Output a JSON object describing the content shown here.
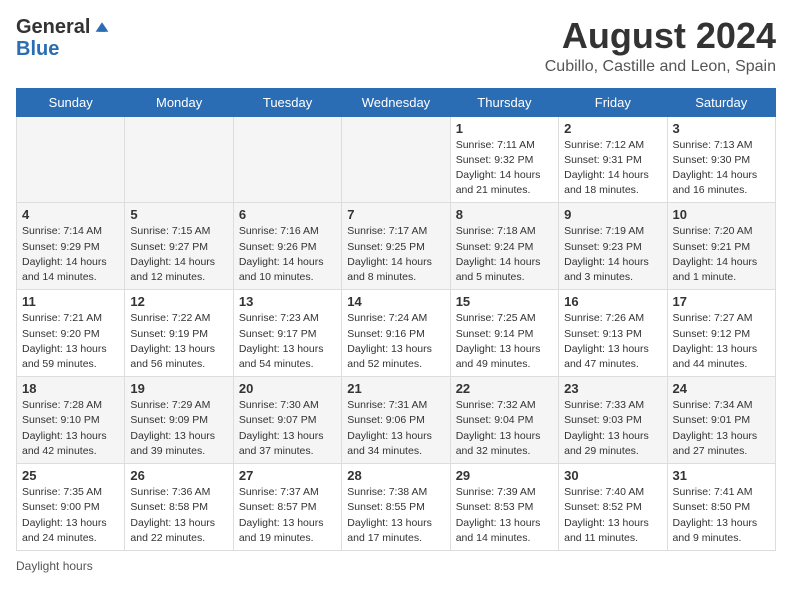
{
  "header": {
    "logo_general": "General",
    "logo_blue": "Blue",
    "month_year": "August 2024",
    "location": "Cubillo, Castille and Leon, Spain"
  },
  "days_of_week": [
    "Sunday",
    "Monday",
    "Tuesday",
    "Wednesday",
    "Thursday",
    "Friday",
    "Saturday"
  ],
  "weeks": [
    [
      {
        "day": "",
        "info": ""
      },
      {
        "day": "",
        "info": ""
      },
      {
        "day": "",
        "info": ""
      },
      {
        "day": "",
        "info": ""
      },
      {
        "day": "1",
        "info": "Sunrise: 7:11 AM\nSunset: 9:32 PM\nDaylight: 14 hours and 21 minutes."
      },
      {
        "day": "2",
        "info": "Sunrise: 7:12 AM\nSunset: 9:31 PM\nDaylight: 14 hours and 18 minutes."
      },
      {
        "day": "3",
        "info": "Sunrise: 7:13 AM\nSunset: 9:30 PM\nDaylight: 14 hours and 16 minutes."
      }
    ],
    [
      {
        "day": "4",
        "info": "Sunrise: 7:14 AM\nSunset: 9:29 PM\nDaylight: 14 hours and 14 minutes."
      },
      {
        "day": "5",
        "info": "Sunrise: 7:15 AM\nSunset: 9:27 PM\nDaylight: 14 hours and 12 minutes."
      },
      {
        "day": "6",
        "info": "Sunrise: 7:16 AM\nSunset: 9:26 PM\nDaylight: 14 hours and 10 minutes."
      },
      {
        "day": "7",
        "info": "Sunrise: 7:17 AM\nSunset: 9:25 PM\nDaylight: 14 hours and 8 minutes."
      },
      {
        "day": "8",
        "info": "Sunrise: 7:18 AM\nSunset: 9:24 PM\nDaylight: 14 hours and 5 minutes."
      },
      {
        "day": "9",
        "info": "Sunrise: 7:19 AM\nSunset: 9:23 PM\nDaylight: 14 hours and 3 minutes."
      },
      {
        "day": "10",
        "info": "Sunrise: 7:20 AM\nSunset: 9:21 PM\nDaylight: 14 hours and 1 minute."
      }
    ],
    [
      {
        "day": "11",
        "info": "Sunrise: 7:21 AM\nSunset: 9:20 PM\nDaylight: 13 hours and 59 minutes."
      },
      {
        "day": "12",
        "info": "Sunrise: 7:22 AM\nSunset: 9:19 PM\nDaylight: 13 hours and 56 minutes."
      },
      {
        "day": "13",
        "info": "Sunrise: 7:23 AM\nSunset: 9:17 PM\nDaylight: 13 hours and 54 minutes."
      },
      {
        "day": "14",
        "info": "Sunrise: 7:24 AM\nSunset: 9:16 PM\nDaylight: 13 hours and 52 minutes."
      },
      {
        "day": "15",
        "info": "Sunrise: 7:25 AM\nSunset: 9:14 PM\nDaylight: 13 hours and 49 minutes."
      },
      {
        "day": "16",
        "info": "Sunrise: 7:26 AM\nSunset: 9:13 PM\nDaylight: 13 hours and 47 minutes."
      },
      {
        "day": "17",
        "info": "Sunrise: 7:27 AM\nSunset: 9:12 PM\nDaylight: 13 hours and 44 minutes."
      }
    ],
    [
      {
        "day": "18",
        "info": "Sunrise: 7:28 AM\nSunset: 9:10 PM\nDaylight: 13 hours and 42 minutes."
      },
      {
        "day": "19",
        "info": "Sunrise: 7:29 AM\nSunset: 9:09 PM\nDaylight: 13 hours and 39 minutes."
      },
      {
        "day": "20",
        "info": "Sunrise: 7:30 AM\nSunset: 9:07 PM\nDaylight: 13 hours and 37 minutes."
      },
      {
        "day": "21",
        "info": "Sunrise: 7:31 AM\nSunset: 9:06 PM\nDaylight: 13 hours and 34 minutes."
      },
      {
        "day": "22",
        "info": "Sunrise: 7:32 AM\nSunset: 9:04 PM\nDaylight: 13 hours and 32 minutes."
      },
      {
        "day": "23",
        "info": "Sunrise: 7:33 AM\nSunset: 9:03 PM\nDaylight: 13 hours and 29 minutes."
      },
      {
        "day": "24",
        "info": "Sunrise: 7:34 AM\nSunset: 9:01 PM\nDaylight: 13 hours and 27 minutes."
      }
    ],
    [
      {
        "day": "25",
        "info": "Sunrise: 7:35 AM\nSunset: 9:00 PM\nDaylight: 13 hours and 24 minutes."
      },
      {
        "day": "26",
        "info": "Sunrise: 7:36 AM\nSunset: 8:58 PM\nDaylight: 13 hours and 22 minutes."
      },
      {
        "day": "27",
        "info": "Sunrise: 7:37 AM\nSunset: 8:57 PM\nDaylight: 13 hours and 19 minutes."
      },
      {
        "day": "28",
        "info": "Sunrise: 7:38 AM\nSunset: 8:55 PM\nDaylight: 13 hours and 17 minutes."
      },
      {
        "day": "29",
        "info": "Sunrise: 7:39 AM\nSunset: 8:53 PM\nDaylight: 13 hours and 14 minutes."
      },
      {
        "day": "30",
        "info": "Sunrise: 7:40 AM\nSunset: 8:52 PM\nDaylight: 13 hours and 11 minutes."
      },
      {
        "day": "31",
        "info": "Sunrise: 7:41 AM\nSunset: 8:50 PM\nDaylight: 13 hours and 9 minutes."
      }
    ]
  ],
  "footer": {
    "daylight_hours": "Daylight hours"
  }
}
